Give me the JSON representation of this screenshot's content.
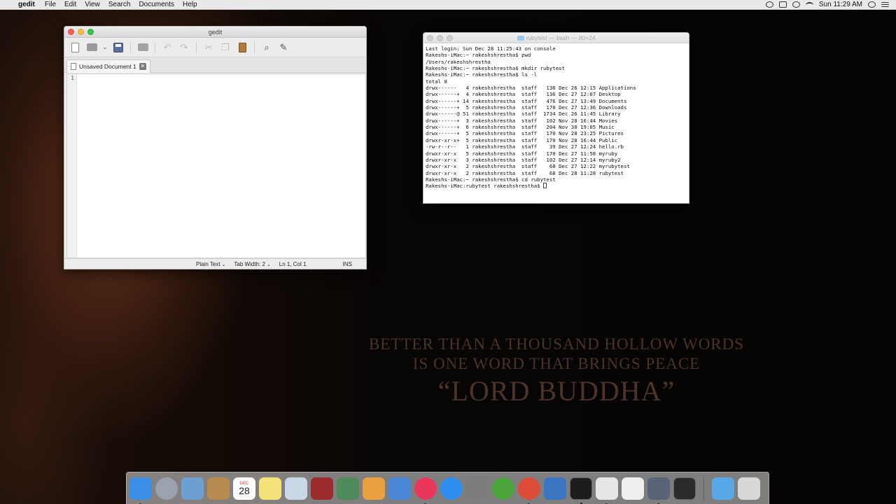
{
  "menubar": {
    "app_name": "gedit",
    "menus": [
      "File",
      "Edit",
      "View",
      "Search",
      "Documents",
      "Help"
    ],
    "clock": "Sun 11:29 AM"
  },
  "gedit": {
    "title": "gedit",
    "tab_label": "Unsaved Document 1",
    "line_number": "1",
    "status": {
      "language": "Plain Text",
      "tab_width": "Tab Width:  2",
      "position": "Ln 1, Col 1",
      "mode": "INS"
    }
  },
  "terminal": {
    "title": "rubytest — bash — 80×24",
    "lines": [
      "Last login: Sun Dec 28 11:25:43 on console",
      "Rakeshs-iMac:~ rakeshshrestha$ pwd",
      "/Users/rakeshshrestha",
      "Rakeshs-iMac:~ rakeshshrestha$ mkdir rubytest",
      "Rakeshs-iMac:~ rakeshshrestha$ ls -l",
      "total 8",
      "drwx------   4 rakeshshrestha  staff   136 Dec 26 12:15 Applications",
      "drwx------+  4 rakeshshrestha  staff   136 Dec 27 12:07 Desktop",
      "drwx------+ 14 rakeshshrestha  staff   476 Dec 27 13:49 Documents",
      "drwx------+  5 rakeshshrestha  staff   170 Dec 27 12:36 Downloads",
      "drwx------@ 51 rakeshshrestha  staff  1734 Dec 26 11:45 Library",
      "drwx------+  3 rakeshshrestha  staff   102 Nov 28 16:44 Movies",
      "drwx------+  6 rakeshshrestha  staff   204 Nov 30 19:05 Music",
      "drwx------+  5 rakeshshrestha  staff   170 Nov 28 23:25 Pictures",
      "drwxr-xr-x+  5 rakeshshrestha  staff   170 Nov 28 16:44 Public",
      "-rw-r--r--   1 rakeshshrestha  staff    39 Dec 27 12:24 hello.rb",
      "drwxr-xr-x   5 rakeshshrestha  staff   170 Dec 27 11:58 myruby",
      "drwxr-xr-x   3 rakeshshrestha  staff   102 Dec 27 12:14 myruby2",
      "drwxr-xr-x   2 rakeshshrestha  staff    68 Dec 27 12:22 myrubytest",
      "drwxr-xr-x   2 rakeshshrestha  staff    68 Dec 28 11:28 rubytest",
      "Rakeshs-iMac:~ rakeshshrestha$ cd rubytest",
      "Rakeshs-iMac:rubytest rakeshshrestha$ "
    ]
  },
  "wallpaper_quote": {
    "line1": "BETTER THAN A THOUSAND HOLLOW WORDS",
    "line2": "IS ONE WORD THAT BRINGS PEACE",
    "line3": "“LORD BUDDHA”"
  },
  "dock": {
    "calendar_month": "DEC",
    "calendar_day": "28",
    "items": [
      {
        "name": "finder-icon",
        "color": "#3a8ee6"
      },
      {
        "name": "launchpad-icon",
        "color": "#9aa3ad"
      },
      {
        "name": "preview-icon",
        "color": "#6d9fd0"
      },
      {
        "name": "contacts-icon",
        "color": "#b78a4f"
      },
      {
        "name": "calendar-icon",
        "color": "#ffffff"
      },
      {
        "name": "notes-icon",
        "color": "#f5e27a"
      },
      {
        "name": "photo-viewer-icon",
        "color": "#c9d7e6"
      },
      {
        "name": "photo-booth-icon",
        "color": "#9b2b2b"
      },
      {
        "name": "iphoto-icon",
        "color": "#4f8a5b"
      },
      {
        "name": "pages-icon",
        "color": "#e8a040"
      },
      {
        "name": "keynote-icon",
        "color": "#4a86d6"
      },
      {
        "name": "itunes-icon",
        "color": "#e8375a"
      },
      {
        "name": "app-store-icon",
        "color": "#2d8ef0"
      },
      {
        "name": "system-preferences-icon",
        "color": "#7c7c7c"
      },
      {
        "name": "utorrent-icon",
        "color": "#49a53a"
      },
      {
        "name": "chrome-icon",
        "color": "#dd4b39"
      },
      {
        "name": "xcode-icon",
        "color": "#3b75c2"
      },
      {
        "name": "terminal-icon",
        "color": "#1d1d1d"
      },
      {
        "name": "textedit-icon",
        "color": "#e6e6e6"
      },
      {
        "name": "script-editor-icon",
        "color": "#efefef"
      },
      {
        "name": "imovie-icon",
        "color": "#5a6478"
      },
      {
        "name": "console-icon",
        "color": "#2b2b2b"
      },
      {
        "name": "folder-icon",
        "color": "#5aa9e6"
      },
      {
        "name": "trash-icon",
        "color": "#d8d8d8"
      }
    ]
  }
}
